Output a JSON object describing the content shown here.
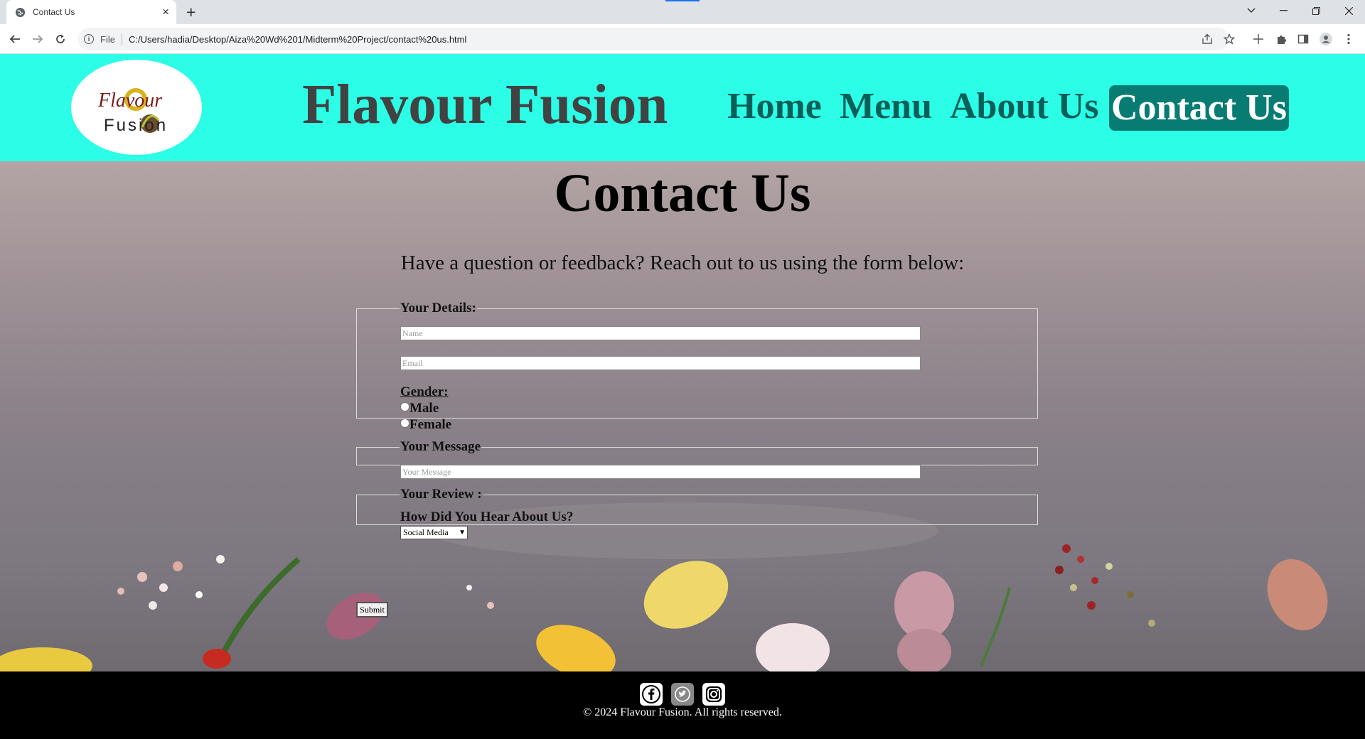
{
  "browser": {
    "tab_title": "Contact Us",
    "new_tab_symbol": "+",
    "close_symbol": "×",
    "address_scheme": "File",
    "address_url": "C:/Users/hadia/Desktop/Aiza%20Wd%201/Midterm%20Project/contact%20us.html"
  },
  "header": {
    "logo_line1": "Flavour",
    "logo_line2": "Fusion",
    "site_title": "Flavour Fusion",
    "nav": {
      "home": "Home",
      "menu": "Menu",
      "about": "About Us",
      "contact": "Contact Us"
    },
    "accent_color": "#2cfde6",
    "active_color": "#087c73"
  },
  "main": {
    "heading": "Contact Us",
    "intro": "Have a question or feedback? Reach out to us using the form below:"
  },
  "form": {
    "details_legend": "Your Details:",
    "name_placeholder": "Name",
    "email_placeholder": "Email",
    "gender_label": "Gender:",
    "gender_options": {
      "male": "Male",
      "female": "Female"
    },
    "message_legend": "Your Message",
    "message_placeholder": "Your Message",
    "review_legend": "Your Review :",
    "hear_label": "How Did You Hear About Us?",
    "hear_selected": "Social Media",
    "submit_label": "Submit"
  },
  "footer": {
    "social": [
      "facebook-icon",
      "twitter-icon",
      "instagram-icon"
    ],
    "copyright": "© 2024 Flavour Fusion. All rights reserved."
  }
}
